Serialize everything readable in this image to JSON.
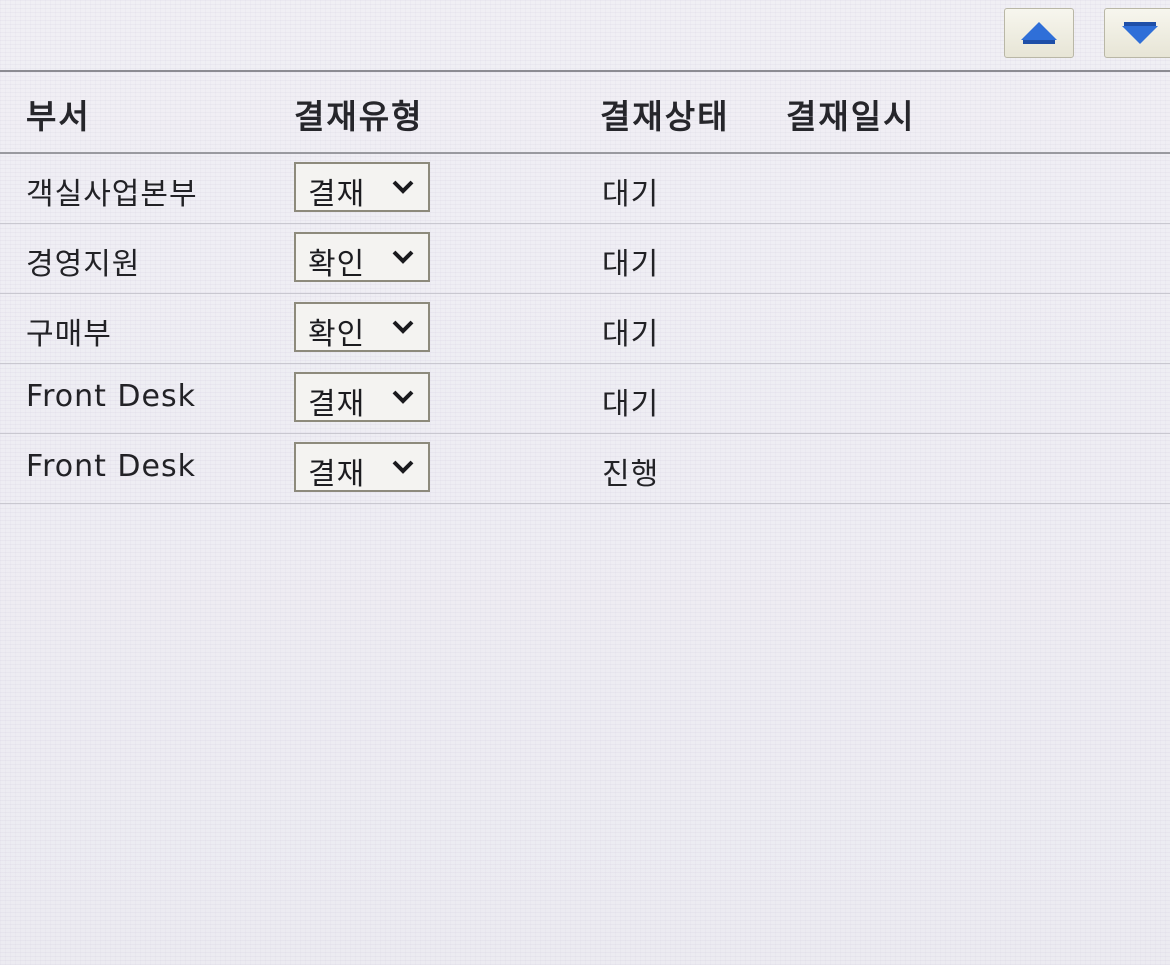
{
  "toolbar": {
    "up_icon": "arrow-up-icon",
    "down_icon": "arrow-down-icon",
    "icon_color": "#2f6fd8"
  },
  "table": {
    "columns": [
      "부서",
      "결재유형",
      "결재상태",
      "결재일시"
    ],
    "rows": [
      {
        "dept": "객실사업본부",
        "type": "결재",
        "status": "대기",
        "date": ""
      },
      {
        "dept": "경영지원",
        "type": "확인",
        "status": "대기",
        "date": ""
      },
      {
        "dept": "구매부",
        "type": "확인",
        "status": "대기",
        "date": ""
      },
      {
        "dept": "Front Desk",
        "type": "결재",
        "status": "대기",
        "date": ""
      },
      {
        "dept": "Front Desk",
        "type": "결재",
        "status": "진행",
        "date": ""
      }
    ]
  }
}
